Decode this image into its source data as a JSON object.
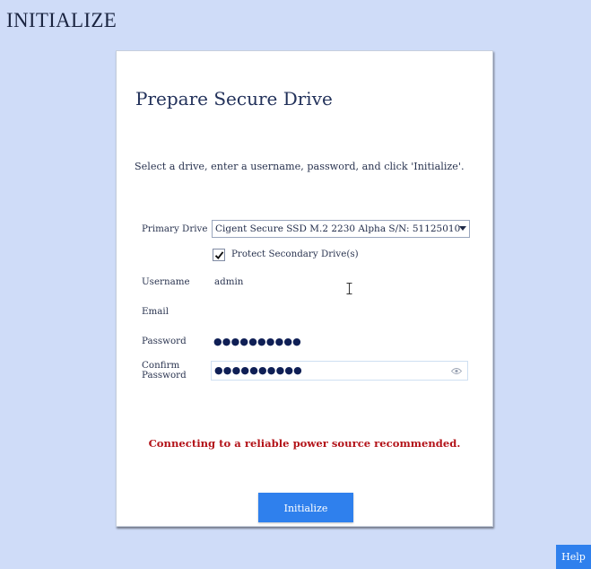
{
  "page": {
    "title": "INITIALIZE"
  },
  "card": {
    "title": "Prepare Secure Drive",
    "instructions": "Select a drive, enter a username, password, and click 'Initialize'."
  },
  "form": {
    "primary_drive_label": "Primary Drive",
    "primary_drive_value": "Cigent Secure SSD M.2 2230 Alpha S/N: 51125010",
    "protect_secondary_label": "Protect Secondary Drive(s)",
    "protect_secondary_checked": true,
    "username_label": "Username",
    "username_value": "admin",
    "email_label": "Email",
    "email_value": "",
    "password_label": "Password",
    "password_value": "●●●●●●●●●●",
    "confirm_password_label": "Confirm Password",
    "confirm_password_value": "●●●●●●●●●●"
  },
  "warning": "Connecting to a reliable power source recommended.",
  "buttons": {
    "initialize": "Initialize",
    "help": "Help"
  },
  "colors": {
    "background": "#cfdcf8",
    "accent": "#2f80ed",
    "warning": "#b3141a"
  },
  "icons": {
    "checkbox": "checkmark-icon",
    "show_password": "eye-icon",
    "cursor": "text-cursor-icon",
    "dropdown": "chevron-down-icon"
  }
}
